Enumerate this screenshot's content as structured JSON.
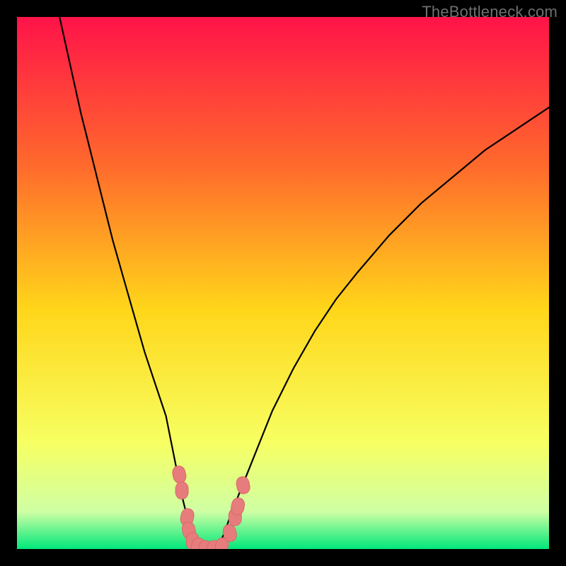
{
  "watermark": "TheBottleneck.com",
  "colors": {
    "frame": "#000000",
    "gradient_top": "#ff1349",
    "gradient_q1": "#ff6a2c",
    "gradient_mid": "#ffd61a",
    "gradient_q3": "#f7ff62",
    "gradient_low": "#cfffa4",
    "gradient_bot": "#00e87b",
    "curve": "#000000",
    "marker_fill": "#e77c7c",
    "marker_stroke": "#d86a6a"
  },
  "chart_data": {
    "type": "line",
    "title": "",
    "xlabel": "",
    "ylabel": "",
    "xlim": [
      0,
      100
    ],
    "ylim": [
      0,
      100
    ],
    "series": [
      {
        "name": "bottleneck-curve",
        "x": [
          8,
          10,
          12,
          14,
          16,
          18,
          20,
          22,
          24,
          26,
          28,
          29,
          30,
          31,
          32,
          33,
          34,
          35,
          36,
          37,
          38,
          39,
          40,
          42,
          44,
          46,
          48,
          52,
          56,
          60,
          64,
          70,
          76,
          82,
          88,
          94,
          100
        ],
        "y": [
          100,
          91,
          82,
          74,
          66,
          58,
          51,
          44,
          37,
          31,
          25,
          20,
          15,
          10,
          6,
          3,
          1,
          0,
          0,
          0,
          1,
          3,
          6,
          11,
          16,
          21,
          26,
          34,
          41,
          47,
          52,
          59,
          65,
          70,
          75,
          79,
          83
        ]
      }
    ],
    "markers": {
      "name": "sample-points",
      "points": [
        {
          "x": 30.5,
          "y": 14
        },
        {
          "x": 31,
          "y": 11
        },
        {
          "x": 32,
          "y": 6
        },
        {
          "x": 32.3,
          "y": 3.5
        },
        {
          "x": 33,
          "y": 1.5
        },
        {
          "x": 34,
          "y": 0.5
        },
        {
          "x": 35.5,
          "y": 0
        },
        {
          "x": 37,
          "y": 0
        },
        {
          "x": 38.5,
          "y": 0.5
        },
        {
          "x": 40,
          "y": 3
        },
        {
          "x": 41,
          "y": 6
        },
        {
          "x": 41.5,
          "y": 8
        },
        {
          "x": 42.5,
          "y": 12
        }
      ]
    }
  }
}
